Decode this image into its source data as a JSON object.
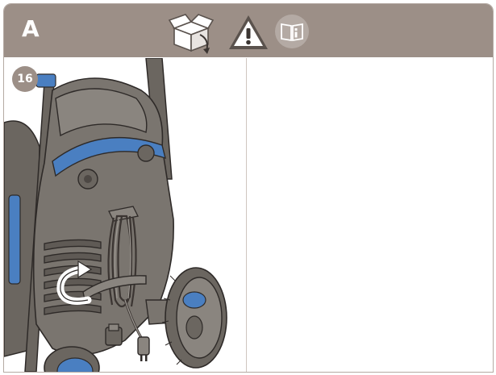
{
  "header": {
    "section_letter": "A",
    "icons": [
      "unbox-icon",
      "warning-icon",
      "read-manual-icon"
    ]
  },
  "step": {
    "number": "16"
  },
  "illustration": {
    "subject": "pressure-washer-cord-hook",
    "accent_color": "#4a7fc1",
    "body_color": "#6b6660"
  },
  "colors": {
    "header_bg": "#9c8f87",
    "border": "#b5aaa3"
  }
}
